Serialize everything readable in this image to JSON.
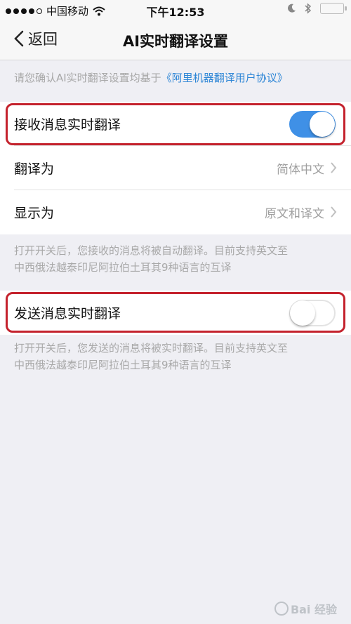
{
  "status_bar": {
    "carrier": "中国移动",
    "time": "下午12:53"
  },
  "nav": {
    "back_label": "返回",
    "title": "AI实时翻译设置"
  },
  "hint": {
    "text": "请您确认AI实时翻译设置均基于",
    "link_text": "《阿里机器翻译用户协议》"
  },
  "receive_section": {
    "toggle_label": "接收消息实时翻译",
    "toggle_on": true,
    "translate_to_label": "翻译为",
    "translate_to_value": "简体中文",
    "display_as_label": "显示为",
    "display_as_value": "原文和译文",
    "description_line1": "打开开关后，您接收的消息将被自动翻译。目前支持英文至",
    "description_line2": "中西俄法越泰印尼阿拉伯土耳其9种语言的互译"
  },
  "send_section": {
    "toggle_label": "发送消息实时翻译",
    "toggle_on": false,
    "description_line1": "打开开关后，您发送的消息将被实时翻译。目前支持英文至",
    "description_line2": "中西俄法越泰印尼阿拉伯土耳其9种语言的互译"
  },
  "watermark": {
    "text": "Bai 经验"
  },
  "colors": {
    "accent": "#3f90e6",
    "link": "#2e86d6",
    "highlight": "#c4222d",
    "background": "#efeff4"
  }
}
